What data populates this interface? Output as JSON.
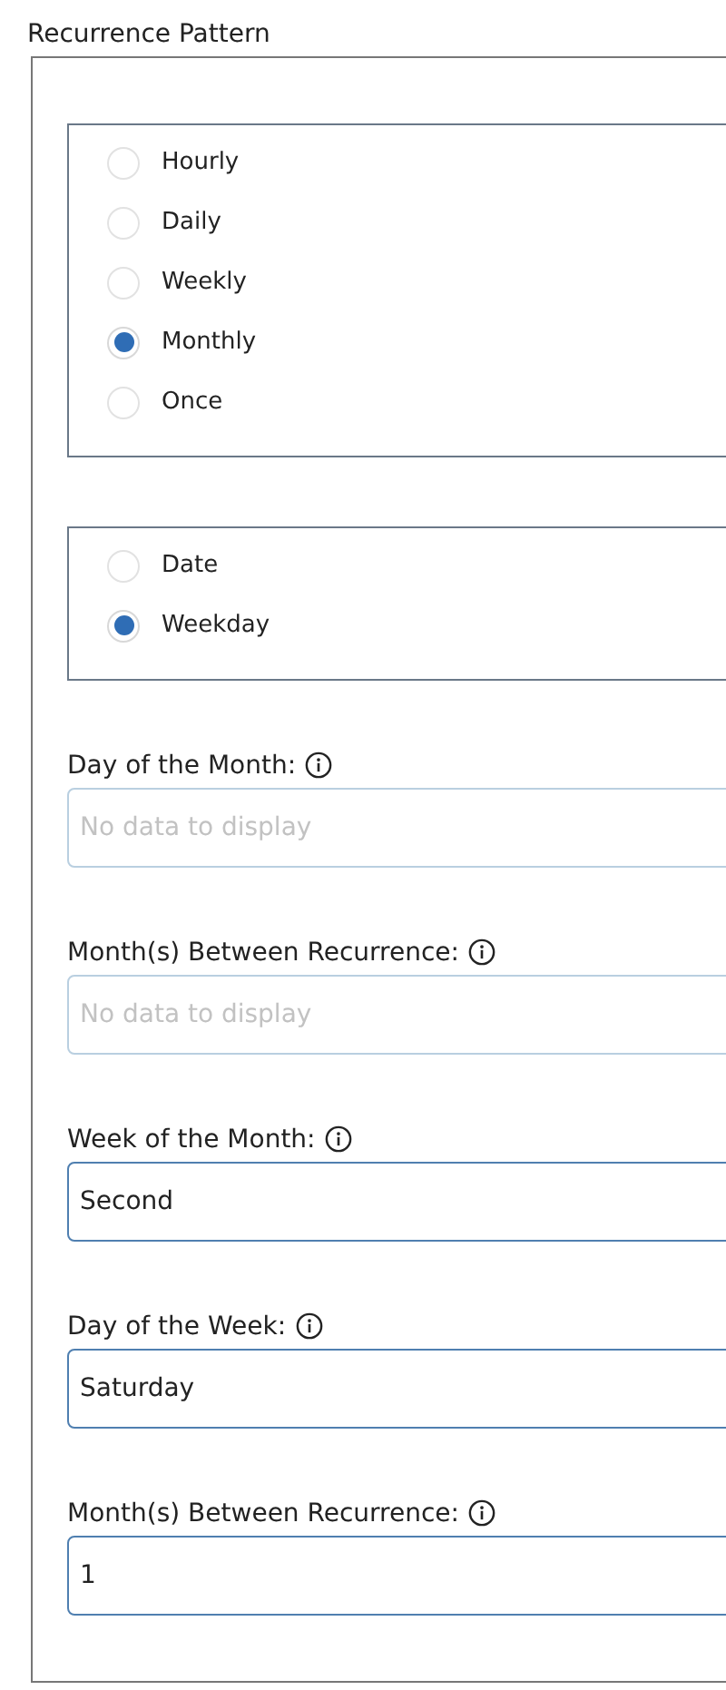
{
  "title": "Recurrence Pattern",
  "radio_groups": [
    {
      "options": [
        {
          "label": "Hourly",
          "selected": false
        },
        {
          "label": "Daily",
          "selected": false
        },
        {
          "label": "Weekly",
          "selected": false
        },
        {
          "label": "Monthly",
          "selected": true
        },
        {
          "label": "Once",
          "selected": false
        }
      ]
    },
    {
      "options": [
        {
          "label": "Date",
          "selected": false
        },
        {
          "label": "Weekday",
          "selected": true
        }
      ]
    }
  ],
  "fields": [
    {
      "label": "Day of the Month:",
      "placeholder": "No data to display",
      "disabled": true
    },
    {
      "label": "Month(s) Between Recurrence:",
      "placeholder": "No data to display",
      "disabled": true
    },
    {
      "label": "Week of the Month:",
      "value": "Second",
      "disabled": false
    },
    {
      "label": "Day of the Week:",
      "value": "Saturday",
      "disabled": false
    },
    {
      "label": "Month(s) Between Recurrence:",
      "value": "1",
      "disabled": false
    }
  ]
}
